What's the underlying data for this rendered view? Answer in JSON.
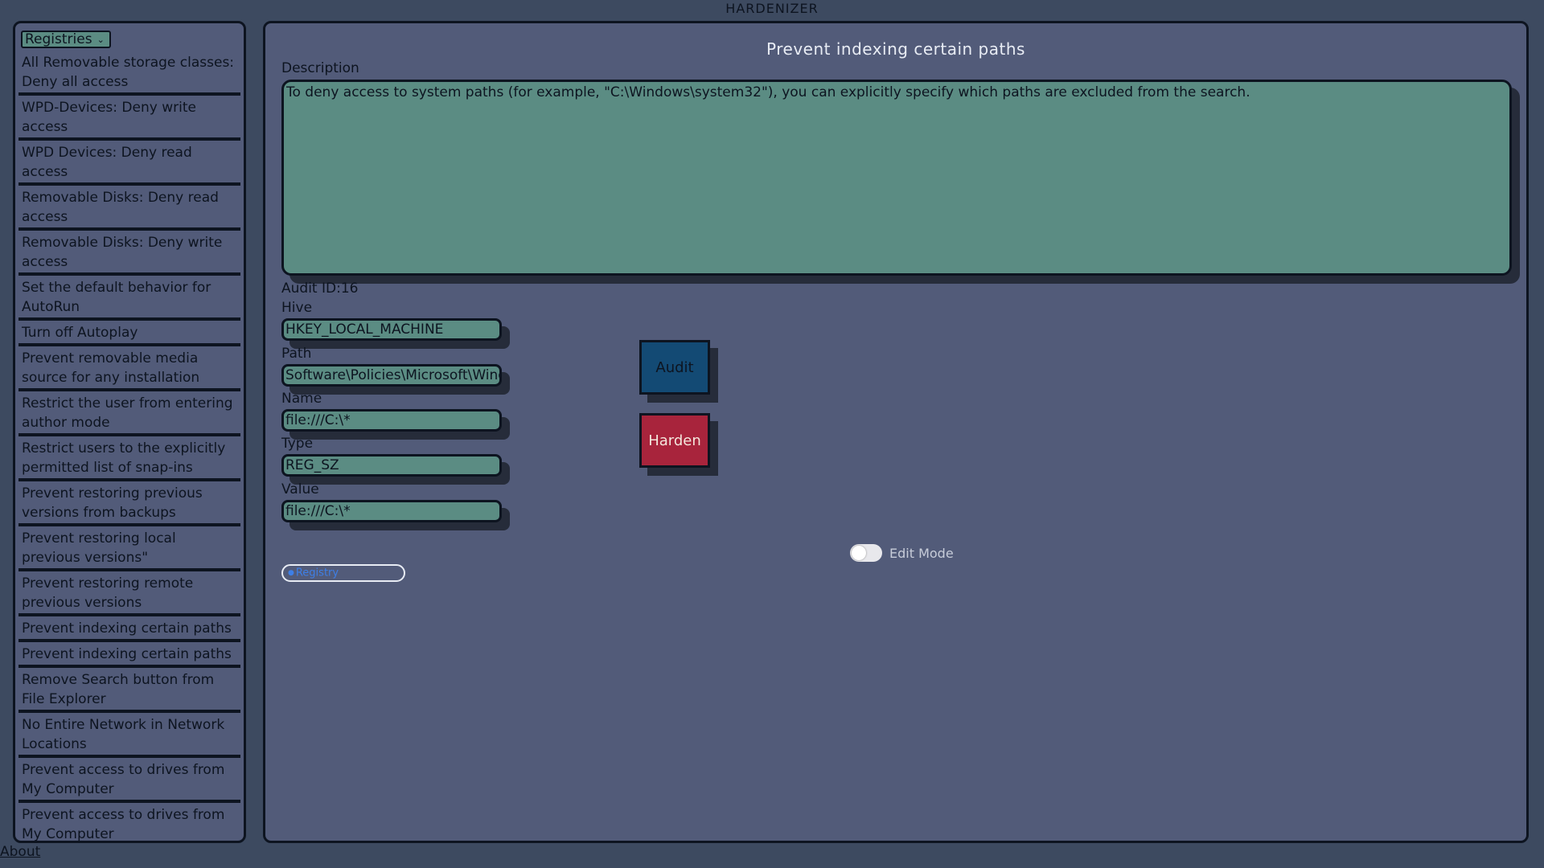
{
  "app": {
    "title": "HARDENIZER"
  },
  "sidebar": {
    "category": "Registries",
    "items": [
      "All Removable storage classes: Deny all access",
      "WPD-Devices: Deny write access",
      "WPD Devices: Deny read access",
      "Removable Disks: Deny read access",
      "Removable Disks: Deny write access",
      "Set the default behavior for AutoRun",
      "Turn off Autoplay",
      "Prevent removable media source for any installation",
      "Restrict the user from entering author mode",
      "Restrict users to the explicitly permitted list of snap-ins",
      "Prevent restoring previous versions from backups",
      "Prevent restoring local previous versions\"",
      "Prevent restoring remote previous versions",
      "Prevent indexing certain paths",
      "Prevent indexing certain paths",
      "Remove Search button from File Explorer",
      "No Entire Network in Network Locations",
      "Prevent access to drives from My Computer",
      "Prevent access to drives from My Computer"
    ],
    "about_label": "About"
  },
  "main": {
    "title": "Prevent indexing certain paths",
    "description_label": "Description",
    "description": "To deny access to system paths (for example, \"C:\\Windows\\system32\"), you can explicitly specify which paths are excluded from the search.",
    "audit_id_text": "Audit ID:16",
    "hive_label": "Hive",
    "hive_value": "HKEY_LOCAL_MACHINE",
    "path_label": "Path",
    "path_value": "Software\\Policies\\Microsoft\\Windows\\Windows Search",
    "name_label": "Name",
    "name_value": "file:///C:\\*",
    "type_label": "Type",
    "type_value": "REG_SZ",
    "value_label": "Value",
    "value_value": "file:///C:\\*",
    "audit_button": "Audit",
    "harden_button": "Harden",
    "edit_mode_label": "Edit Mode",
    "tag_label": "Registry"
  }
}
